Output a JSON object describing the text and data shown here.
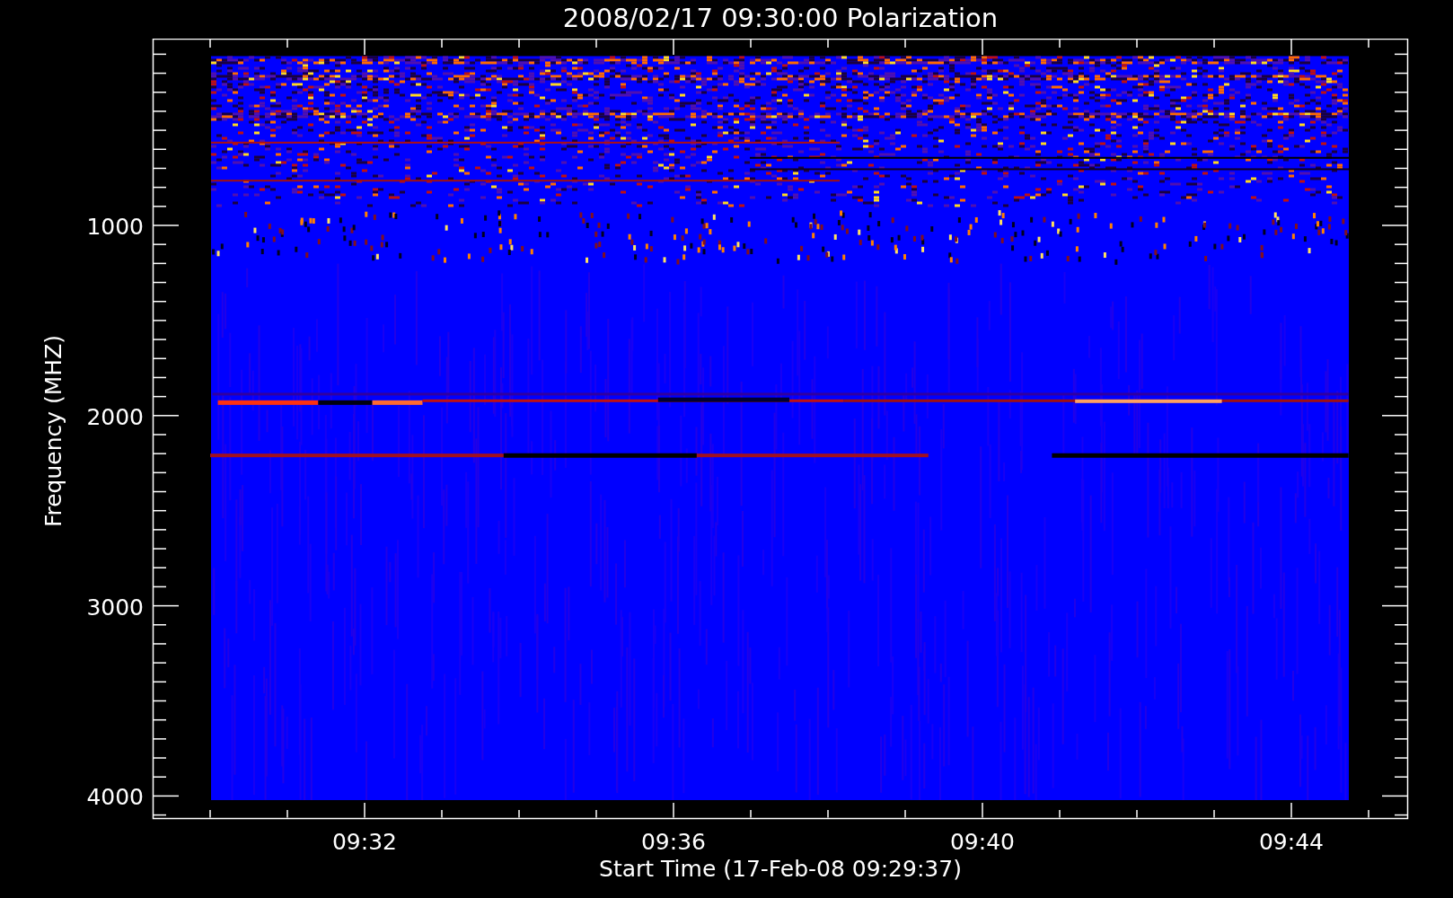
{
  "title": "2008/02/17 09:30:00 Polarization",
  "y_axis": {
    "label": "Frequency (MHZ)",
    "ticks": [
      "1000",
      "2000",
      "3000",
      "4000"
    ]
  },
  "x_axis": {
    "label": "Start Time (17-Feb-08 09:29:37)",
    "ticks": [
      "09:32",
      "09:36",
      "09:40",
      "09:44"
    ]
  }
}
